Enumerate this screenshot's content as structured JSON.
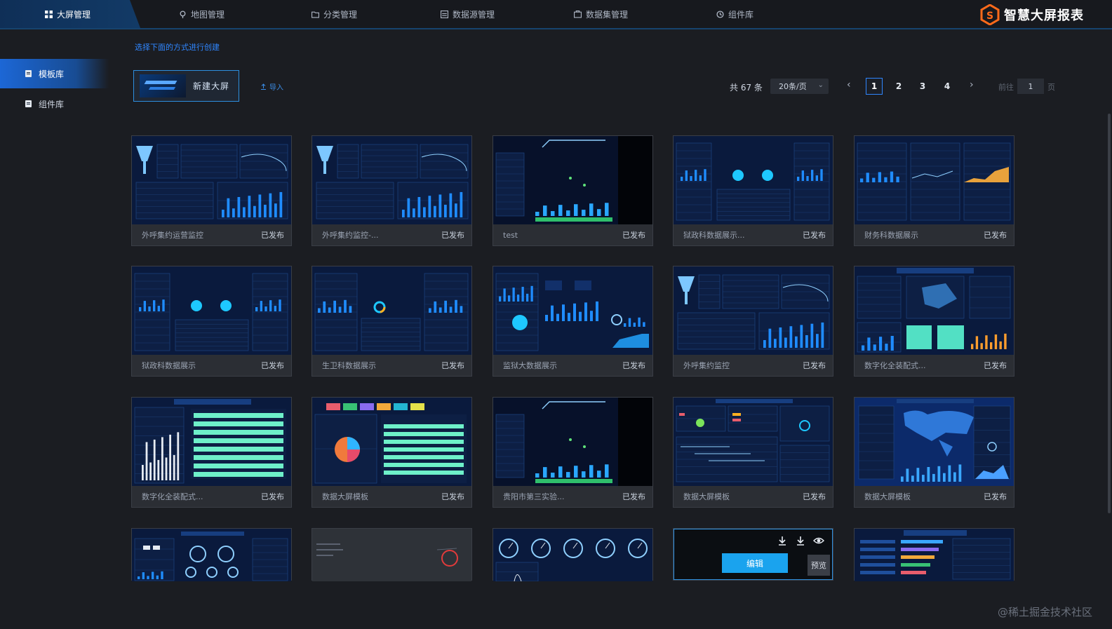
{
  "topnav": {
    "items": [
      {
        "label": "大屏管理",
        "icon": "grid-icon"
      },
      {
        "label": "地图管理",
        "icon": "map-pin-icon"
      },
      {
        "label": "分类管理",
        "icon": "folder-icon"
      },
      {
        "label": "数据源管理",
        "icon": "database-icon"
      },
      {
        "label": "数据集管理",
        "icon": "dataset-icon"
      },
      {
        "label": "组件库",
        "icon": "component-icon"
      }
    ],
    "brand": "智慧大屏报表"
  },
  "sidebar": {
    "items": [
      {
        "label": "模板库"
      },
      {
        "label": "组件库"
      }
    ]
  },
  "main": {
    "hint": "选择下面的方式进行创建",
    "new_screen_label": "新建大屏",
    "import_label": "导入"
  },
  "pagination": {
    "total": "共 67 条",
    "page_size": "20条/页",
    "pages": [
      "1",
      "2",
      "3",
      "4"
    ],
    "current_page": "1",
    "goto_label": "前往",
    "goto_value": "1",
    "goto_unit": "页"
  },
  "cards": [
    {
      "title": "外呼集约运营监控",
      "status": "已发布"
    },
    {
      "title": "外呼集约监控-...",
      "status": "已发布"
    },
    {
      "title": "test",
      "status": "已发布"
    },
    {
      "title": "狱政科数据展示...",
      "status": "已发布"
    },
    {
      "title": "财务科数据展示",
      "status": "已发布"
    },
    {
      "title": "狱政科数据展示",
      "status": "已发布"
    },
    {
      "title": "生卫科数据展示",
      "status": "已发布"
    },
    {
      "title": "监狱大数据展示",
      "status": "已发布"
    },
    {
      "title": "外呼集约监控",
      "status": "已发布"
    },
    {
      "title": "数字化全装配式...",
      "status": "已发布"
    },
    {
      "title": "数字化全装配式...",
      "status": "已发布"
    },
    {
      "title": "数据大屏模板",
      "status": "已发布"
    },
    {
      "title": "贵阳市第三实验...",
      "status": "已发布"
    },
    {
      "title": "数据大屏模板",
      "status": "已发布"
    },
    {
      "title": "数据大屏模板",
      "status": "已发布"
    }
  ],
  "hover": {
    "edit_label": "编辑",
    "preview_label": "预览"
  },
  "watermark": "@稀土掘金技术社区",
  "colors": {
    "accent": "#2f86ff",
    "edit_button": "#1aa3ee",
    "topbar_active": "#123a66",
    "page_bg": "#1b1d22"
  }
}
